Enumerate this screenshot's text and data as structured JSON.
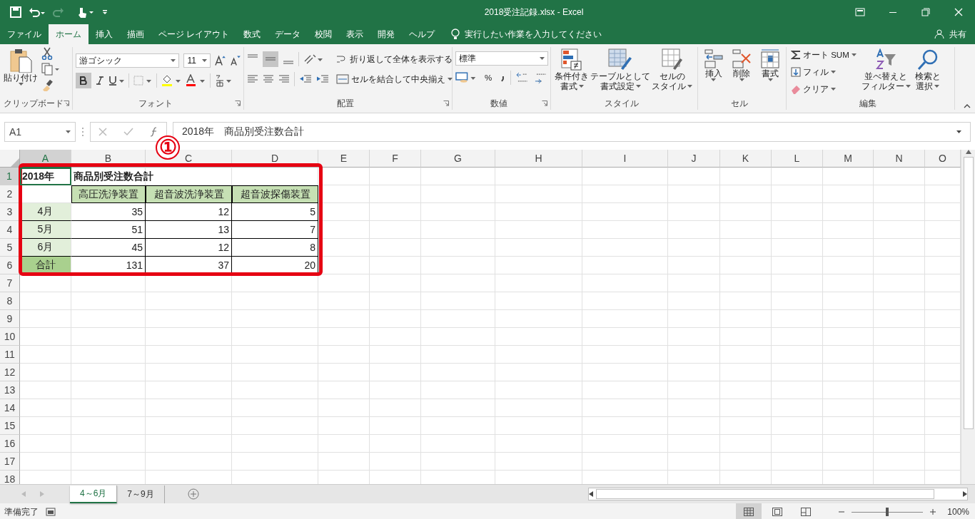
{
  "window": {
    "title": "2018受注記録.xlsx  -  Excel"
  },
  "menu_tabs": [
    {
      "label": "ファイル",
      "selected": false
    },
    {
      "label": "ホーム",
      "selected": true
    },
    {
      "label": "挿入",
      "selected": false
    },
    {
      "label": "描画",
      "selected": false
    },
    {
      "label": "ページ レイアウト",
      "selected": false
    },
    {
      "label": "数式",
      "selected": false
    },
    {
      "label": "データ",
      "selected": false
    },
    {
      "label": "校閲",
      "selected": false
    },
    {
      "label": "表示",
      "selected": false
    },
    {
      "label": "開発",
      "selected": false
    },
    {
      "label": "ヘルプ",
      "selected": false
    }
  ],
  "tell_me": {
    "placeholder": "実行したい作業を入力してください"
  },
  "share": "共有",
  "ribbon": {
    "clipboard": {
      "label": "クリップボード",
      "paste": "貼り付け"
    },
    "font": {
      "label": "フォント",
      "font_name": "游ゴシック",
      "font_size": "11",
      "bold_pressed": true
    },
    "alignment": {
      "label": "配置",
      "wrap": "折り返して全体を表示する",
      "merge": "セルを結合して中央揃え",
      "middle_pressed": true
    },
    "number": {
      "label": "数値",
      "format": "標準",
      "percent": "%"
    },
    "styles": {
      "label": "スタイル",
      "buttons": [
        {
          "kind": "conditional",
          "lines": [
            "条件付き",
            "書式"
          ]
        },
        {
          "kind": "table",
          "lines": [
            "テーブルとして",
            "書式設定"
          ]
        },
        {
          "kind": "cellstyle",
          "lines": [
            "セルの",
            "スタイル"
          ]
        }
      ]
    },
    "cells": {
      "label": "セル",
      "buttons": [
        {
          "kind": "insert",
          "label": "挿入"
        },
        {
          "kind": "delete",
          "label": "削除"
        },
        {
          "kind": "format",
          "label": "書式"
        }
      ]
    },
    "editing": {
      "label": "編集",
      "autosum": "オート SUM",
      "fill": "フィル",
      "clear": "クリア",
      "sort": [
        "並べ替えと",
        "フィルター"
      ],
      "find": [
        "検索と",
        "選択"
      ]
    }
  },
  "formula_bar": {
    "name_box": "A1",
    "formula": "2018年　商品別受注数合計"
  },
  "annotation": "①",
  "columns": [
    {
      "label": "A",
      "selected": true
    },
    {
      "label": "B",
      "selected": false
    },
    {
      "label": "C",
      "selected": false
    },
    {
      "label": "D",
      "selected": false
    },
    {
      "label": "E",
      "selected": false
    },
    {
      "label": "F",
      "selected": false
    },
    {
      "label": "G",
      "selected": false
    },
    {
      "label": "H",
      "selected": false
    },
    {
      "label": "I",
      "selected": false
    },
    {
      "label": "J",
      "selected": false
    },
    {
      "label": "K",
      "selected": false
    },
    {
      "label": "L",
      "selected": false
    },
    {
      "label": "M",
      "selected": false
    },
    {
      "label": "N",
      "selected": false
    },
    {
      "label": "O",
      "selected": false
    }
  ],
  "row_numbers": [
    {
      "label": "1",
      "selected": true
    },
    {
      "label": "2",
      "selected": false
    },
    {
      "label": "3",
      "selected": false
    },
    {
      "label": "4",
      "selected": false
    },
    {
      "label": "5",
      "selected": false
    },
    {
      "label": "6",
      "selected": false
    },
    {
      "label": "7",
      "selected": false
    },
    {
      "label": "8",
      "selected": false
    },
    {
      "label": "9",
      "selected": false
    },
    {
      "label": "10",
      "selected": false
    },
    {
      "label": "11",
      "selected": false
    },
    {
      "label": "12",
      "selected": false
    },
    {
      "label": "13",
      "selected": false
    },
    {
      "label": "14",
      "selected": false
    },
    {
      "label": "15",
      "selected": false
    },
    {
      "label": "16",
      "selected": false
    },
    {
      "label": "17",
      "selected": false
    },
    {
      "label": "18",
      "selected": false
    }
  ],
  "rows": [
    [
      {
        "text": "2018年",
        "kind": "title"
      },
      {
        "text": "商品別受注数合計",
        "kind": "title"
      },
      {
        "kind": "empty"
      },
      {
        "kind": "empty"
      }
    ],
    [
      {
        "kind": "empty"
      },
      {
        "text": "高圧洗浄装置",
        "kind": "header",
        "color": "#c6e0b4"
      },
      {
        "text": "超音波洗浄装置",
        "kind": "header",
        "color": "#c6e0b4"
      },
      {
        "text": "超音波探傷装置",
        "kind": "header",
        "color": "#c6e0b4"
      }
    ],
    [
      {
        "text": "4月",
        "kind": "label",
        "color": "#e2efda"
      },
      {
        "text": "35",
        "kind": "number"
      },
      {
        "text": "12",
        "kind": "number"
      },
      {
        "text": "5",
        "kind": "number"
      }
    ],
    [
      {
        "text": "5月",
        "kind": "label",
        "color": "#e2efda"
      },
      {
        "text": "51",
        "kind": "number"
      },
      {
        "text": "13",
        "kind": "number"
      },
      {
        "text": "7",
        "kind": "number"
      }
    ],
    [
      {
        "text": "6月",
        "kind": "label",
        "color": "#e2efda"
      },
      {
        "text": "45",
        "kind": "number"
      },
      {
        "text": "12",
        "kind": "number"
      },
      {
        "text": "8",
        "kind": "number"
      }
    ],
    [
      {
        "text": "合計",
        "kind": "label",
        "color": "#a9d08e"
      },
      {
        "text": "131",
        "kind": "number"
      },
      {
        "text": "37",
        "kind": "number"
      },
      {
        "text": "20",
        "kind": "number"
      }
    ]
  ],
  "sheet_tabs": [
    {
      "label": "4～6月",
      "selected": true
    },
    {
      "label": "7～9月",
      "selected": false
    }
  ],
  "status_bar": {
    "text": "準備完了",
    "zoom": "100%",
    "zoom_slider": {
      "level": 0.5
    },
    "views": [
      {
        "kind": "normal",
        "selected": true
      },
      {
        "kind": "layout",
        "selected": false
      },
      {
        "kind": "pagebreak",
        "selected": false
      }
    ]
  }
}
